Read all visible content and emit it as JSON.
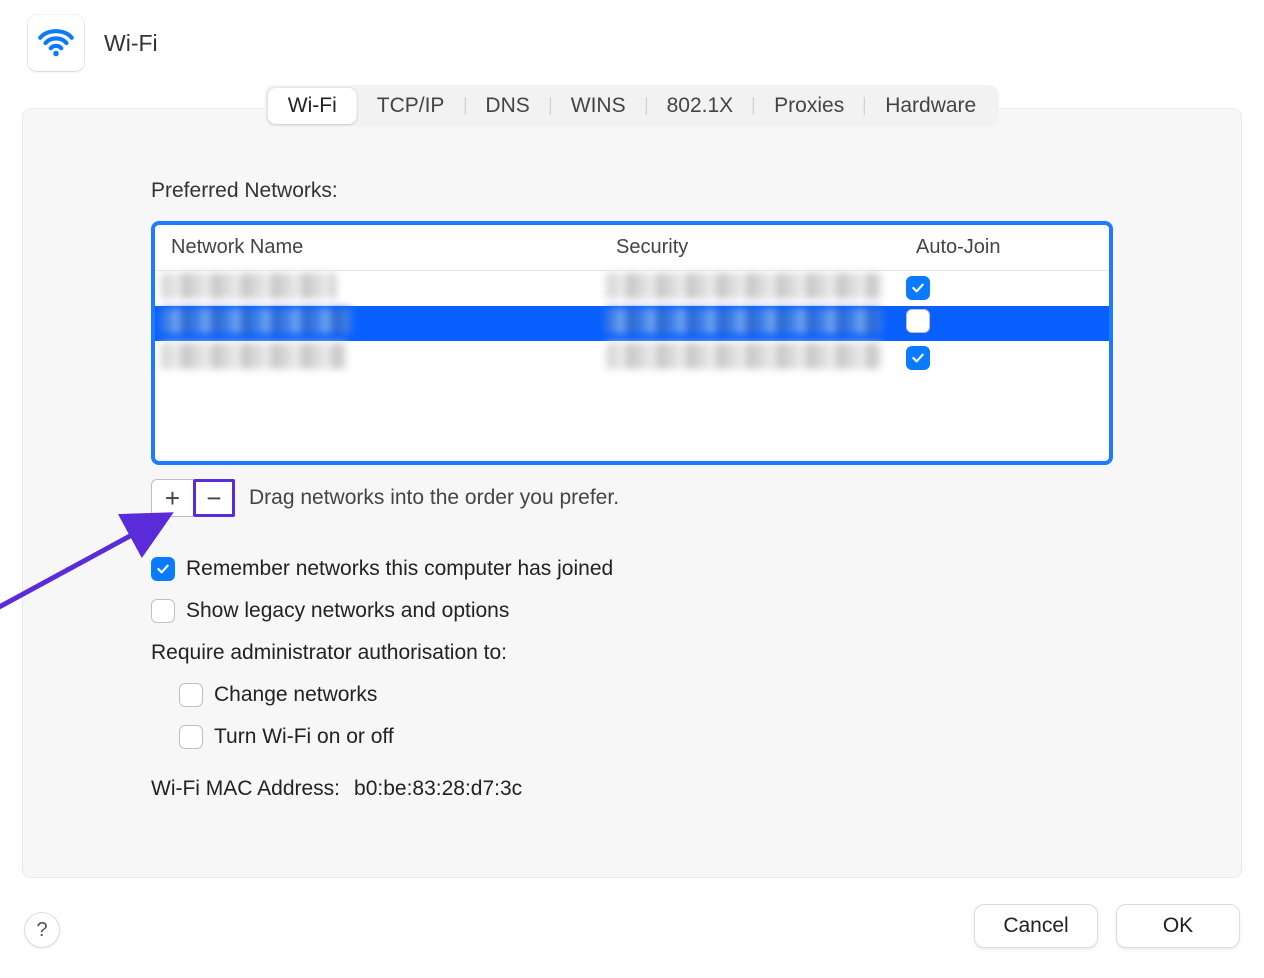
{
  "header": {
    "title": "Wi-Fi"
  },
  "tabs": {
    "items": [
      {
        "label": "Wi-Fi",
        "active": true
      },
      {
        "label": "TCP/IP",
        "active": false
      },
      {
        "label": "DNS",
        "active": false
      },
      {
        "label": "WINS",
        "active": false
      },
      {
        "label": "802.1X",
        "active": false
      },
      {
        "label": "Proxies",
        "active": false
      },
      {
        "label": "Hardware",
        "active": false
      }
    ]
  },
  "networks": {
    "section_label": "Preferred Networks:",
    "columns": {
      "name": "Network Name",
      "security": "Security",
      "autojoin": "Auto-Join"
    },
    "rows": [
      {
        "name_redacted": true,
        "security_redacted": true,
        "autojoin": true,
        "selected": false
      },
      {
        "name_redacted": true,
        "security_redacted": true,
        "autojoin": false,
        "selected": true
      },
      {
        "name_redacted": true,
        "security_redacted": true,
        "autojoin": true,
        "selected": false
      }
    ],
    "add_label": "+",
    "remove_label": "−",
    "drag_hint": "Drag networks into the order you prefer."
  },
  "options": {
    "remember": {
      "label": "Remember networks this computer has joined",
      "checked": true
    },
    "legacy": {
      "label": "Show legacy networks and options",
      "checked": false
    },
    "auth_label": "Require administrator authorisation to:",
    "auth_change": {
      "label": "Change networks",
      "checked": false
    },
    "auth_toggle": {
      "label": "Turn Wi-Fi on or off",
      "checked": false
    }
  },
  "mac": {
    "label": "Wi-Fi MAC Address:",
    "value": "b0:be:83:28:d7:3c"
  },
  "footer": {
    "cancel": "Cancel",
    "ok": "OK",
    "help": "?"
  }
}
